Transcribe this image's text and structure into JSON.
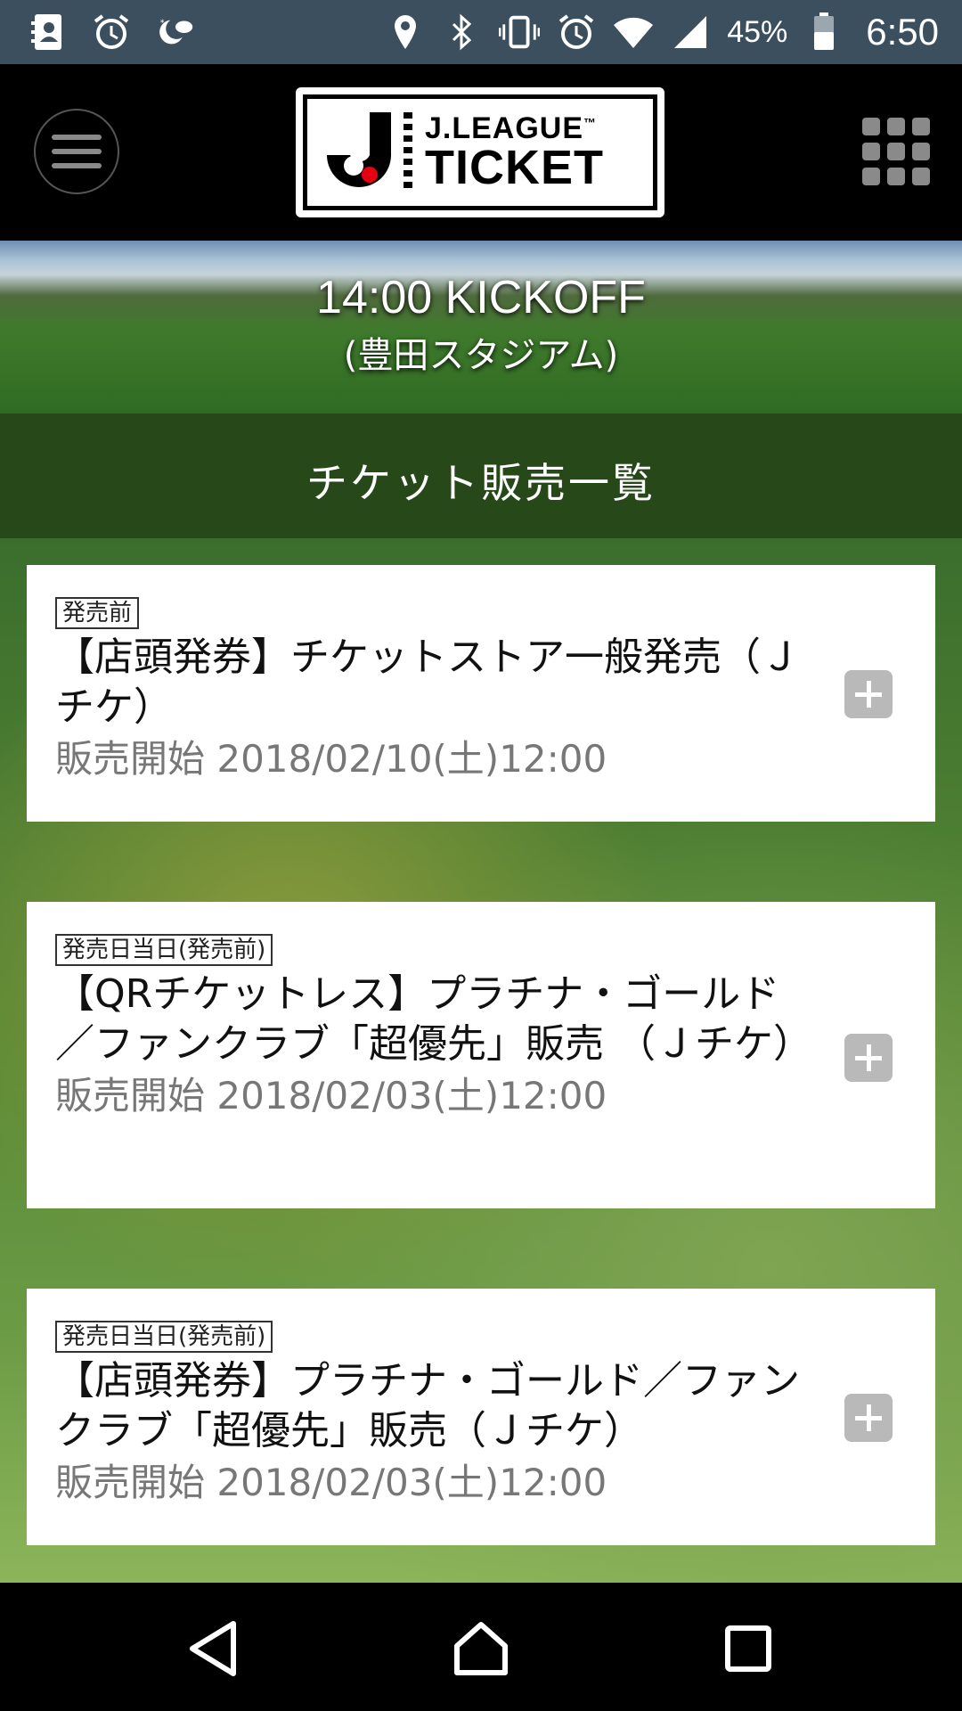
{
  "status_bar": {
    "icons_left": [
      "contacts-icon",
      "alarm-icon",
      "night-mode-icon"
    ],
    "icons_right": [
      "location-icon",
      "bluetooth-icon",
      "vibrate-icon",
      "alarm-icon",
      "wifi-icon",
      "signal-icon",
      "battery-icon"
    ],
    "battery": "45%",
    "time": "6:50"
  },
  "header": {
    "logo_line1": "J.LEAGUE",
    "logo_tm": "™",
    "logo_line2": "TICKET",
    "menu_icon": "hamburger-icon",
    "apps_icon": "grid-icon"
  },
  "hero": {
    "kickoff": "14:00 KICKOFF",
    "venue": "(豊田スタジアム)"
  },
  "section": {
    "title": "チケット販売一覧"
  },
  "tickets": [
    {
      "badge": "発売前",
      "title": "【店頭発券】チケットストア一般発売（Ｊチケ）",
      "date": "販売開始 2018/02/10(土)12:00"
    },
    {
      "badge": "発売日当日(発売前)",
      "title": "【QRチケットレス】プラチナ・ゴールド／ファンクラブ「超優先」販売 （Ｊチケ）",
      "date": "販売開始 2018/02/03(土)12:00"
    },
    {
      "badge": "発売日当日(発売前)",
      "title": "【店頭発券】プラチナ・ゴールド／ファンクラブ「超優先」販売（Ｊチケ）",
      "date": "販売開始 2018/02/03(土)12:00"
    }
  ],
  "nav": {
    "back": "back-icon",
    "home": "home-icon",
    "recents": "recents-icon"
  },
  "colors": {
    "status_bar": "#3c4f5f",
    "header": "#000000",
    "card": "#ffffff",
    "plus_button": "#b9b9b9"
  }
}
